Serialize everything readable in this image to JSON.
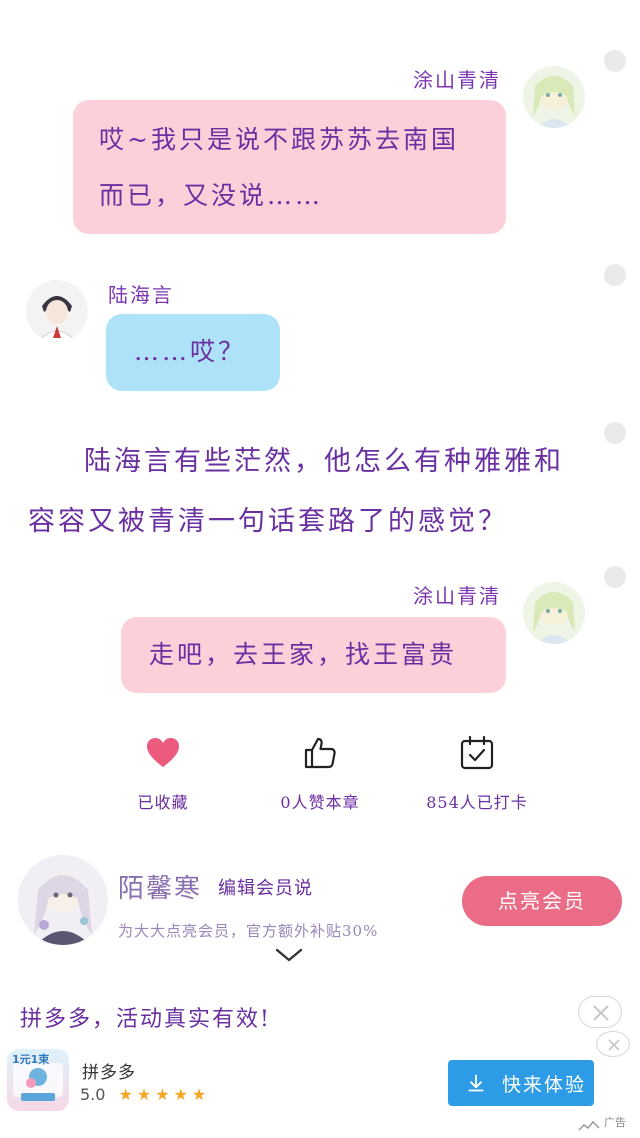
{
  "messages": [
    {
      "speaker": "涂山青清",
      "lines": [
        "哎~我只是说不跟苏苏去南国",
        "而已，又没说……"
      ]
    },
    {
      "speaker": "陆海言",
      "lines": [
        "……哎？"
      ]
    },
    {
      "speaker": "涂山青清",
      "lines": [
        "走吧，去王家，找王富贵"
      ]
    }
  ],
  "narration": "陆海言有些茫然，他怎么有种雅雅和容容又被青清一句话套路了的感觉？",
  "actions": {
    "favorite_label": "已收藏",
    "like_label": "0人赞本章",
    "checkin_label": "854人已打卡"
  },
  "member": {
    "name": "陌馨寒",
    "role": "编辑会员说",
    "subtitle": "为大大点亮会员，官方额外补贴30%",
    "button_label": "点亮会员"
  },
  "ad": {
    "headline": "拼多多，活动真实有效!",
    "app_name": "拼多多",
    "rating": "5.0",
    "button_label": "快来体验",
    "ad_label": "广告",
    "icon_text": "1元1束"
  },
  "colors": {
    "pink_bubble": "#fcd0d9",
    "blue_bubble": "#aee2f8",
    "text_purple": "#6a2fa0",
    "member_button": "#ea6c87",
    "ad_button": "#2e9be6",
    "heart": "#ec5a7e"
  }
}
